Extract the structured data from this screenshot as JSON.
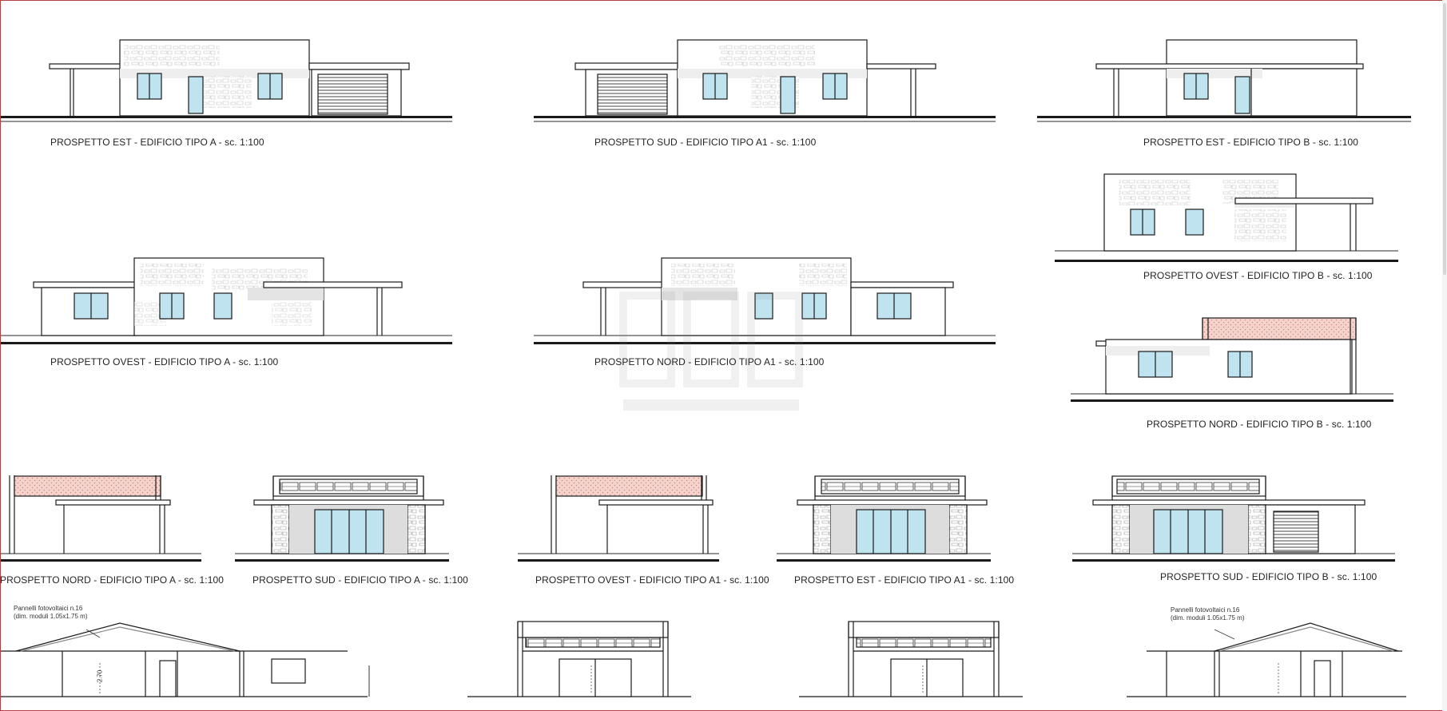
{
  "captions": {
    "c1": "PROSPETTO EST - EDIFICIO TIPO A - sc. 1:100",
    "c2": "PROSPETTO SUD - EDIFICIO TIPO A1 - sc. 1:100",
    "c3": "PROSPETTO EST - EDIFICIO TIPO B - sc. 1:100",
    "c4": "PROSPETTO OVEST - EDIFICIO TIPO B - sc. 1:100",
    "c5": "PROSPETTO OVEST - EDIFICIO TIPO A - sc. 1:100",
    "c6": "PROSPETTO NORD - EDIFICIO TIPO A1 - sc. 1:100",
    "c7": "PROSPETTO NORD - EDIFICIO TIPO B - sc. 1:100",
    "c8": "PROSPETTO NORD - EDIFICIO TIPO A - sc. 1:100",
    "c9": "PROSPETTO SUD - EDIFICIO TIPO A - sc. 1:100",
    "c10": "PROSPETTO OVEST - EDIFICIO TIPO A1 - sc. 1:100",
    "c11": "PROSPETTO EST - EDIFICIO TIPO A1 - sc. 1:100",
    "c12": "PROSPETTO SUD - EDIFICIO TIPO B - sc. 1:100"
  },
  "notes": {
    "pv_left_line1": "Pannelli fotovoltaici n.16",
    "pv_left_line2": "(dim. moduli 1.05x1.75 m)",
    "pv_right_line1": "Pannelli fotovoltaici n.16",
    "pv_right_line2": "(dim. moduli 1.05x1.75 m)",
    "dim": "2.70"
  },
  "colors": {
    "line": "#1a1a1a",
    "glass": "#bfe3ef",
    "pergola": "#f3c9c0",
    "stone": "#9a9a9a",
    "shadow": "#e0e0e0",
    "frame": "#b0413e"
  }
}
